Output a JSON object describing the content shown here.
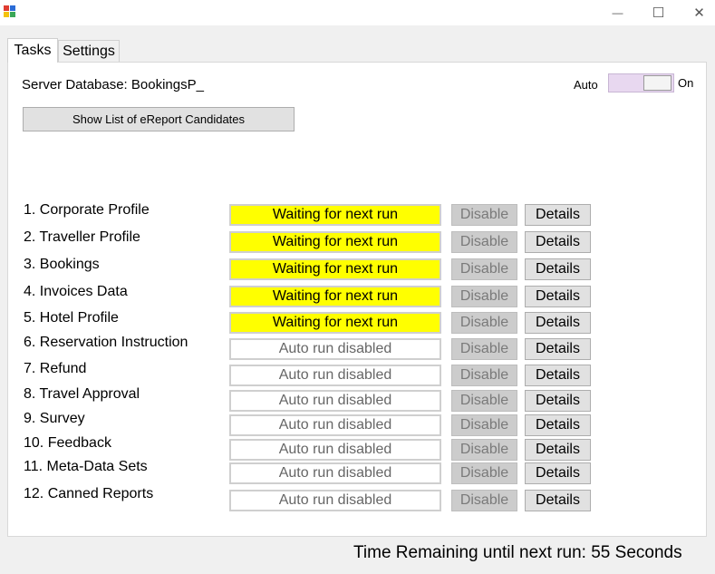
{
  "window": {
    "minimize_glyph": "—",
    "maximize_glyph": "☐",
    "close_glyph": "✕"
  },
  "tabs": [
    {
      "label": "Tasks",
      "active": true
    },
    {
      "label": "Settings",
      "active": false
    }
  ],
  "header": {
    "server_database": "Server Database: BookingsP_",
    "auto_label": "Auto",
    "toggle_state_label": "On",
    "toggle_on": true,
    "show_list_button": "Show List of eReport Candidates"
  },
  "tasks": [
    {
      "label": "1. Corporate Profile",
      "status": "Waiting for next run",
      "state": "waiting",
      "disable_label": "Disable",
      "details_label": "Details"
    },
    {
      "label": "2. Traveller Profile",
      "status": "Waiting for next run",
      "state": "waiting",
      "disable_label": "Disable",
      "details_label": "Details"
    },
    {
      "label": "3. Bookings",
      "status": "Waiting for next run",
      "state": "waiting",
      "disable_label": "Disable",
      "details_label": "Details"
    },
    {
      "label": "4. Invoices Data",
      "status": "Waiting for next run",
      "state": "waiting",
      "disable_label": "Disable",
      "details_label": "Details"
    },
    {
      "label": "5. Hotel Profile",
      "status": "Waiting for next run",
      "state": "waiting",
      "disable_label": "Disable",
      "details_label": "Details"
    },
    {
      "label": "6. Reservation Instruction",
      "status": "Auto run disabled",
      "state": "disabled",
      "disable_label": "Disable",
      "details_label": "Details"
    },
    {
      "label": "7. Refund",
      "status": "Auto run disabled",
      "state": "disabled",
      "disable_label": "Disable",
      "details_label": "Details"
    },
    {
      "label": "8. Travel Approval",
      "status": "Auto run disabled",
      "state": "disabled",
      "disable_label": "Disable",
      "details_label": "Details"
    },
    {
      "label": "9. Survey",
      "status": "Auto run disabled",
      "state": "disabled",
      "disable_label": "Disable",
      "details_label": "Details"
    },
    {
      "label": "10. Feedback",
      "status": "Auto run disabled",
      "state": "disabled",
      "disable_label": "Disable",
      "details_label": "Details"
    },
    {
      "label": "11. Meta-Data Sets",
      "status": "Auto run disabled",
      "state": "disabled",
      "disable_label": "Disable",
      "details_label": "Details"
    },
    {
      "label": "12. Canned Reports",
      "status": "Auto run disabled",
      "state": "disabled",
      "disable_label": "Disable",
      "details_label": "Details"
    }
  ],
  "footer": {
    "time_remaining": "Time Remaining until next run: 55 Seconds"
  },
  "colors": {
    "waiting_status": "#ffff00",
    "toggle_track": "#e8d8f0",
    "disable_button": "#cccccc"
  }
}
